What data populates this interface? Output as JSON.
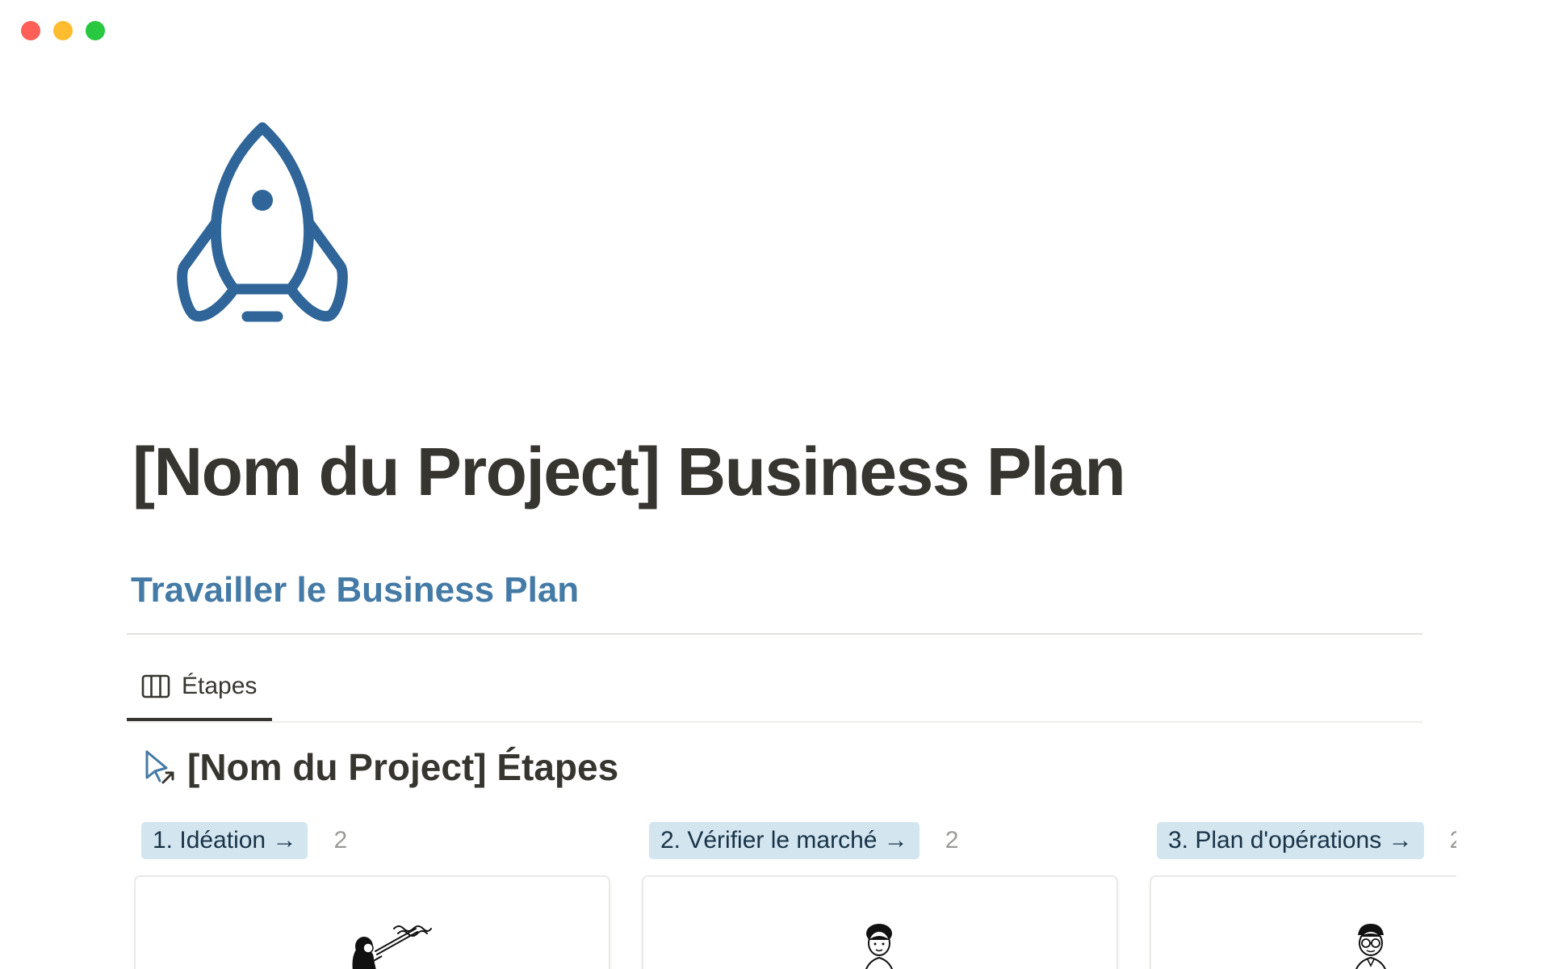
{
  "window": {
    "controls": [
      "close",
      "minimize",
      "maximize"
    ]
  },
  "page": {
    "icon": "rocket-icon",
    "title": "[Nom du Project] Business Plan",
    "section_heading": "Travailler le Business Plan"
  },
  "view_tabs": [
    {
      "label": "Étapes",
      "icon": "board-icon",
      "active": true
    }
  ],
  "database": {
    "icon": "cursor-arrow-icon",
    "title": "[Nom du Project] Étapes"
  },
  "board": {
    "columns": [
      {
        "label": "1. Idéation →",
        "count": "2",
        "illustration": "woman-with-telescope-illustration"
      },
      {
        "label": "2. Vérifier le marché →",
        "count": "2",
        "illustration": "woman-portrait-illustration"
      },
      {
        "label": "3. Plan d'opérations →",
        "count": "2",
        "illustration": "man-with-glasses-illustration"
      }
    ]
  },
  "colors": {
    "title": "#37352f",
    "heading_blue": "#447aa6",
    "rocket_blue": "#2f6598",
    "pill_bg": "#d3e5ef",
    "pill_text": "#183347",
    "count_gray": "#9b9a97"
  }
}
